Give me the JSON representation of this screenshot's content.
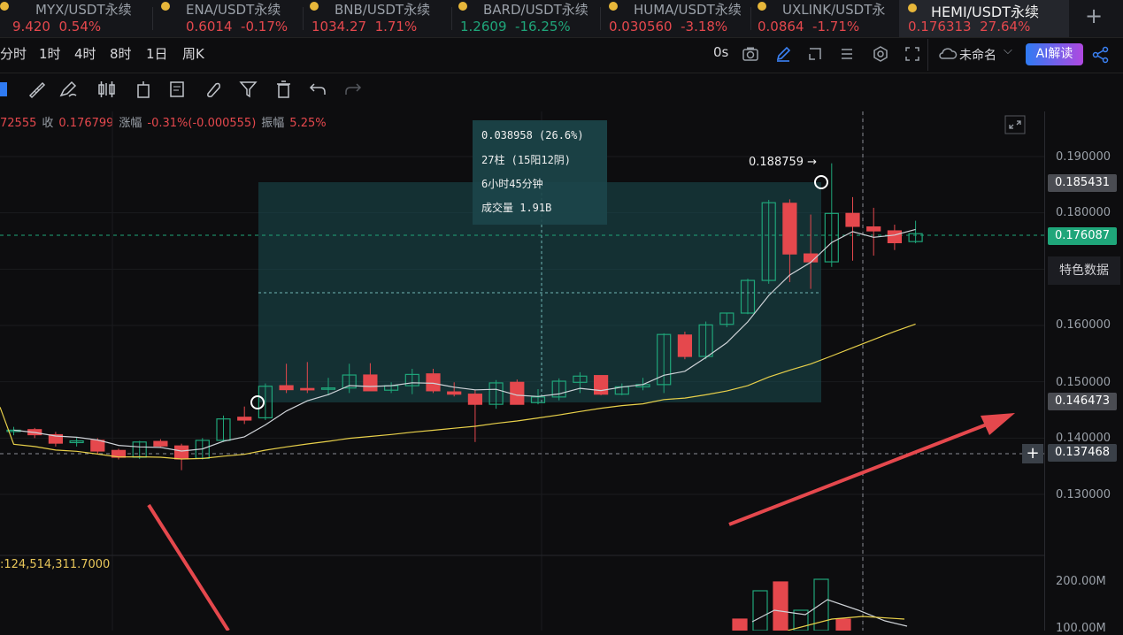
{
  "tabs": [
    {
      "name": "MYX/USDT永续",
      "price": "9.420",
      "change": "0.54%",
      "dir": "up_red"
    },
    {
      "name": "ENA/USDT永续",
      "price": "0.6014",
      "change": "-0.17%",
      "dir": "down"
    },
    {
      "name": "BNB/USDT永续",
      "price": "1034.27",
      "change": "1.71%",
      "dir": "up_red"
    },
    {
      "name": "BARD/USDT永续",
      "price": "1.2609",
      "change": "-16.25%",
      "dir": "green"
    },
    {
      "name": "HUMA/USDT永续",
      "price": "0.030560",
      "change": "-3.18%",
      "dir": "down"
    },
    {
      "name": "UXLINK/USDT永",
      "price": "0.0864",
      "change": "-1.71%",
      "dir": "down"
    },
    {
      "name": "HEMI/USDT永续",
      "price": "0.176313",
      "change": "27.64%",
      "dir": "active"
    }
  ],
  "timeframes": [
    "分时",
    "1时",
    "4时",
    "8时",
    "1日",
    "周K"
  ],
  "toolbar_right": {
    "seconds": "0s",
    "layout_name": "未命名",
    "ai_label": "AI解读"
  },
  "ohlc": {
    "open_partial": "72555",
    "close_label": "收",
    "close": "0.176799",
    "change_label": "涨幅",
    "change": "-0.31%(-0.000555)",
    "amp_label": "振幅",
    "amp": "5.25%"
  },
  "measure": {
    "diff": "0.038958 (26.6%)",
    "bars": "27柱 (15阳12阴)",
    "duration": "6小时45分钟",
    "volume": "成交量 1.91B"
  },
  "high_marker": "0.188759 →",
  "axis_ticks": [
    "0.190000",
    "0.180000",
    "0.160000",
    "0.150000",
    "0.140000",
    "0.130000"
  ],
  "price_tags": {
    "p1": "0.185431",
    "p2": "0.176087",
    "p3": "0.146473",
    "p4": "0.137468"
  },
  "feature_button": "特色数据",
  "vol_label": ":124,514,311.7000",
  "vol_axis": [
    "200.00M",
    "100.00M"
  ],
  "colors": {
    "up": "#1fa67a",
    "down": "#e5484d",
    "ma_white": "#cfd3d8",
    "ma_yellow": "#e8d04a",
    "accent": "#2f7bf3"
  },
  "chart_data": {
    "type": "candlestick",
    "candles": [
      [
        0.1412,
        0.142,
        0.1405,
        0.1414
      ],
      [
        0.1415,
        0.1418,
        0.14,
        0.1406
      ],
      [
        0.1406,
        0.1411,
        0.1385,
        0.1391
      ],
      [
        0.1392,
        0.1401,
        0.1385,
        0.1395
      ],
      [
        0.1396,
        0.14,
        0.1372,
        0.1377
      ],
      [
        0.1378,
        0.1381,
        0.1362,
        0.1366
      ],
      [
        0.1366,
        0.1395,
        0.1363,
        0.1393
      ],
      [
        0.1394,
        0.1398,
        0.1383,
        0.1386
      ],
      [
        0.1386,
        0.139,
        0.1343,
        0.1363
      ],
      [
        0.1364,
        0.14,
        0.1362,
        0.1396
      ],
      [
        0.1396,
        0.144,
        0.1393,
        0.1434
      ],
      [
        0.1437,
        0.1456,
        0.1425,
        0.1432
      ],
      [
        0.1436,
        0.1497,
        0.1432,
        0.1492
      ],
      [
        0.1493,
        0.1532,
        0.148,
        0.1486
      ],
      [
        0.1488,
        0.1535,
        0.148,
        0.1487
      ],
      [
        0.1487,
        0.1507,
        0.1476,
        0.1489
      ],
      [
        0.1489,
        0.1532,
        0.148,
        0.1512
      ],
      [
        0.1512,
        0.1533,
        0.1486,
        0.1484
      ],
      [
        0.1485,
        0.1499,
        0.148,
        0.1493
      ],
      [
        0.1493,
        0.1523,
        0.1478,
        0.1513
      ],
      [
        0.1514,
        0.1523,
        0.148,
        0.1484
      ],
      [
        0.1482,
        0.1499,
        0.1474,
        0.1478
      ],
      [
        0.1478,
        0.1486,
        0.1393,
        0.146
      ],
      [
        0.146,
        0.1503,
        0.1452,
        0.1498
      ],
      [
        0.1499,
        0.1504,
        0.146,
        0.146
      ],
      [
        0.1463,
        0.1487,
        0.146,
        0.1473
      ],
      [
        0.1473,
        0.1506,
        0.1467,
        0.1501
      ],
      [
        0.1499,
        0.1517,
        0.148,
        0.151
      ],
      [
        0.1511,
        0.1506,
        0.1476,
        0.1478
      ],
      [
        0.1478,
        0.1497,
        0.1476,
        0.1491
      ],
      [
        0.1491,
        0.1507,
        0.1485,
        0.1495
      ],
      [
        0.1495,
        0.1586,
        0.148,
        0.1584
      ],
      [
        0.1583,
        0.1589,
        0.154,
        0.1545
      ],
      [
        0.1545,
        0.1607,
        0.154,
        0.1601
      ],
      [
        0.1602,
        0.1622,
        0.1597,
        0.1622
      ],
      [
        0.1622,
        0.1683,
        0.162,
        0.168
      ],
      [
        0.168,
        0.1823,
        0.1674,
        0.1818
      ],
      [
        0.1817,
        0.1824,
        0.1677,
        0.1727
      ],
      [
        0.1727,
        0.1797,
        0.1665,
        0.1713
      ],
      [
        0.1713,
        0.1888,
        0.1704,
        0.1799
      ],
      [
        0.1799,
        0.1828,
        0.1715,
        0.1776
      ],
      [
        0.1775,
        0.1809,
        0.1724,
        0.1768
      ],
      [
        0.1768,
        0.1779,
        0.1734,
        0.1747
      ],
      [
        0.1749,
        0.1786,
        0.1746,
        0.1763
      ]
    ],
    "ylim": [
      0.125,
      0.195
    ]
  }
}
